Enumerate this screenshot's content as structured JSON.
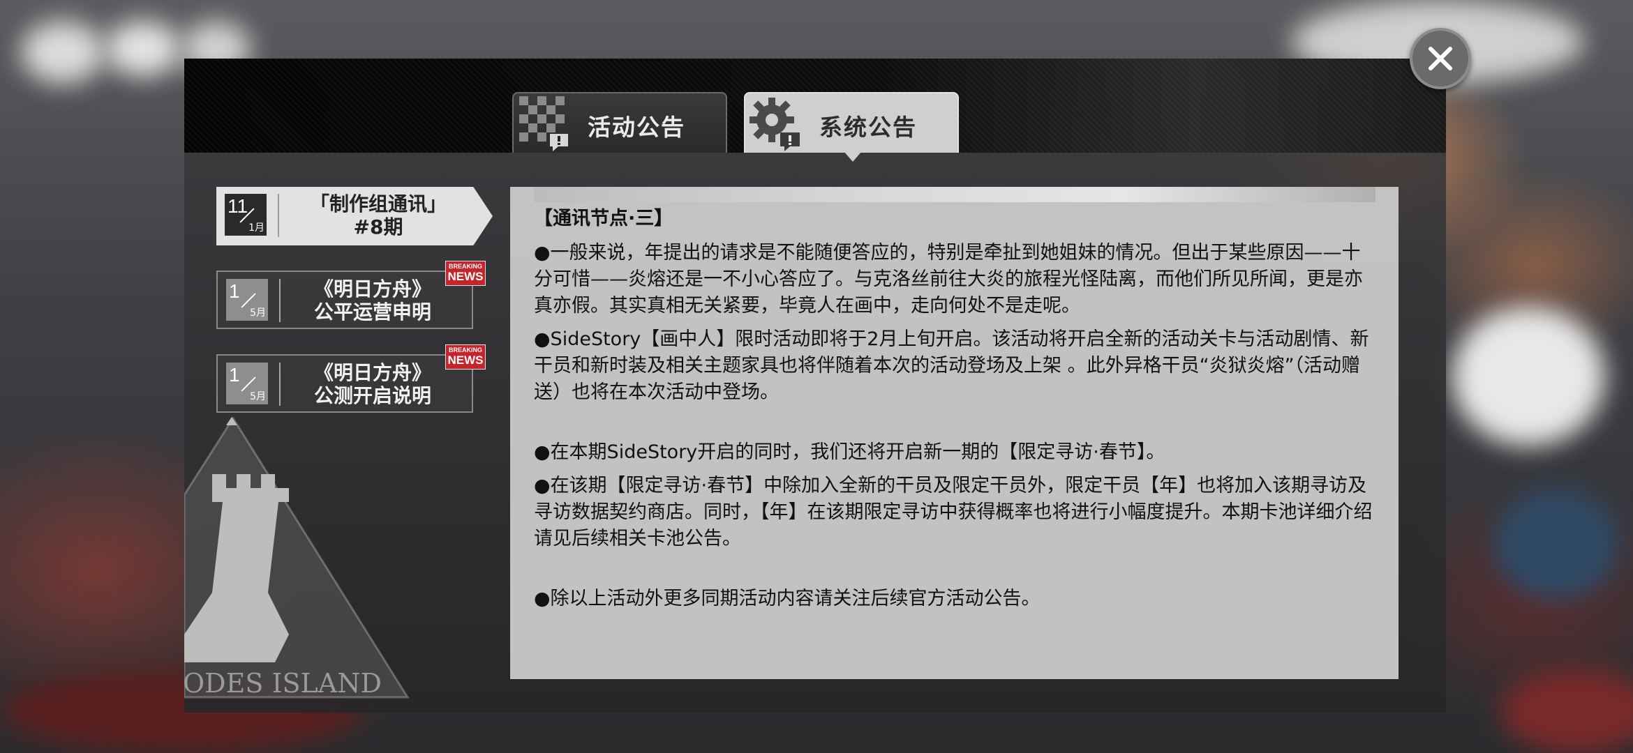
{
  "tabs": {
    "activity_label": "活动公告",
    "system_label": "系统公告"
  },
  "watermark": "ODES ISLAND",
  "announcements": [
    {
      "day": "11",
      "month": "1月",
      "title_line1": "「制作组通讯」",
      "title_line2": "#8期",
      "selected": true,
      "badge": false
    },
    {
      "day": "1",
      "month": "5月",
      "title_line1": "《明日方舟》",
      "title_line2": "公平运营申明",
      "selected": false,
      "badge": true
    },
    {
      "day": "1",
      "month": "5月",
      "title_line1": "《明日方舟》",
      "title_line2": "公测开启说明",
      "selected": false,
      "badge": true
    }
  ],
  "news_badge": {
    "top": "BREAKING",
    "bottom": "NEWS"
  },
  "content": {
    "title": "【通讯节点·三】",
    "paragraphs": [
      "●一般来说，年提出的请求是不能随便答应的，特别是牵扯到她姐妹的情况。但出于某些原因——十分可惜——炎熔还是一不小心答应了。与克洛丝前往大炎的旅程光怪陆离，而他们所见所闻，更是亦真亦假。其实真相无关紧要，毕竟人在画中，走向何处不是走呢。",
      "●SideStory【画中人】限时活动即将于2月上旬开启。该活动将开启全新的活动关卡与活动剧情、新干员和新时装及相关主题家具也将伴随着本次的活动登场及上架 。此外异格干员“炎狱炎熔”（活动赠送）也将在本次活动中登场。",
      "●在本期SideStory开启的同时，我们还将开启新一期的【限定寻访·春节】。",
      "●在该期【限定寻访·春节】中除加入全新的干员及限定干员外，限定干员【年】也将加入该期寻访及寻访数据契约商店。同时，【年】在该期限定寻访中获得概率也将进行小幅度提升。本期卡池详细介绍请见后续相关卡池公告。",
      "●除以上活动外更多同期活动内容请关注后续官方活动公告。"
    ]
  },
  "colors": {
    "accent_red": "#c8232b",
    "tab_active": "#cfcfcf",
    "tab_inactive": "#2a2a2c"
  },
  "icons": {
    "close": "close-icon",
    "activity_tab": "checkered-flag-alert-icon",
    "system_tab": "gear-alert-icon"
  }
}
